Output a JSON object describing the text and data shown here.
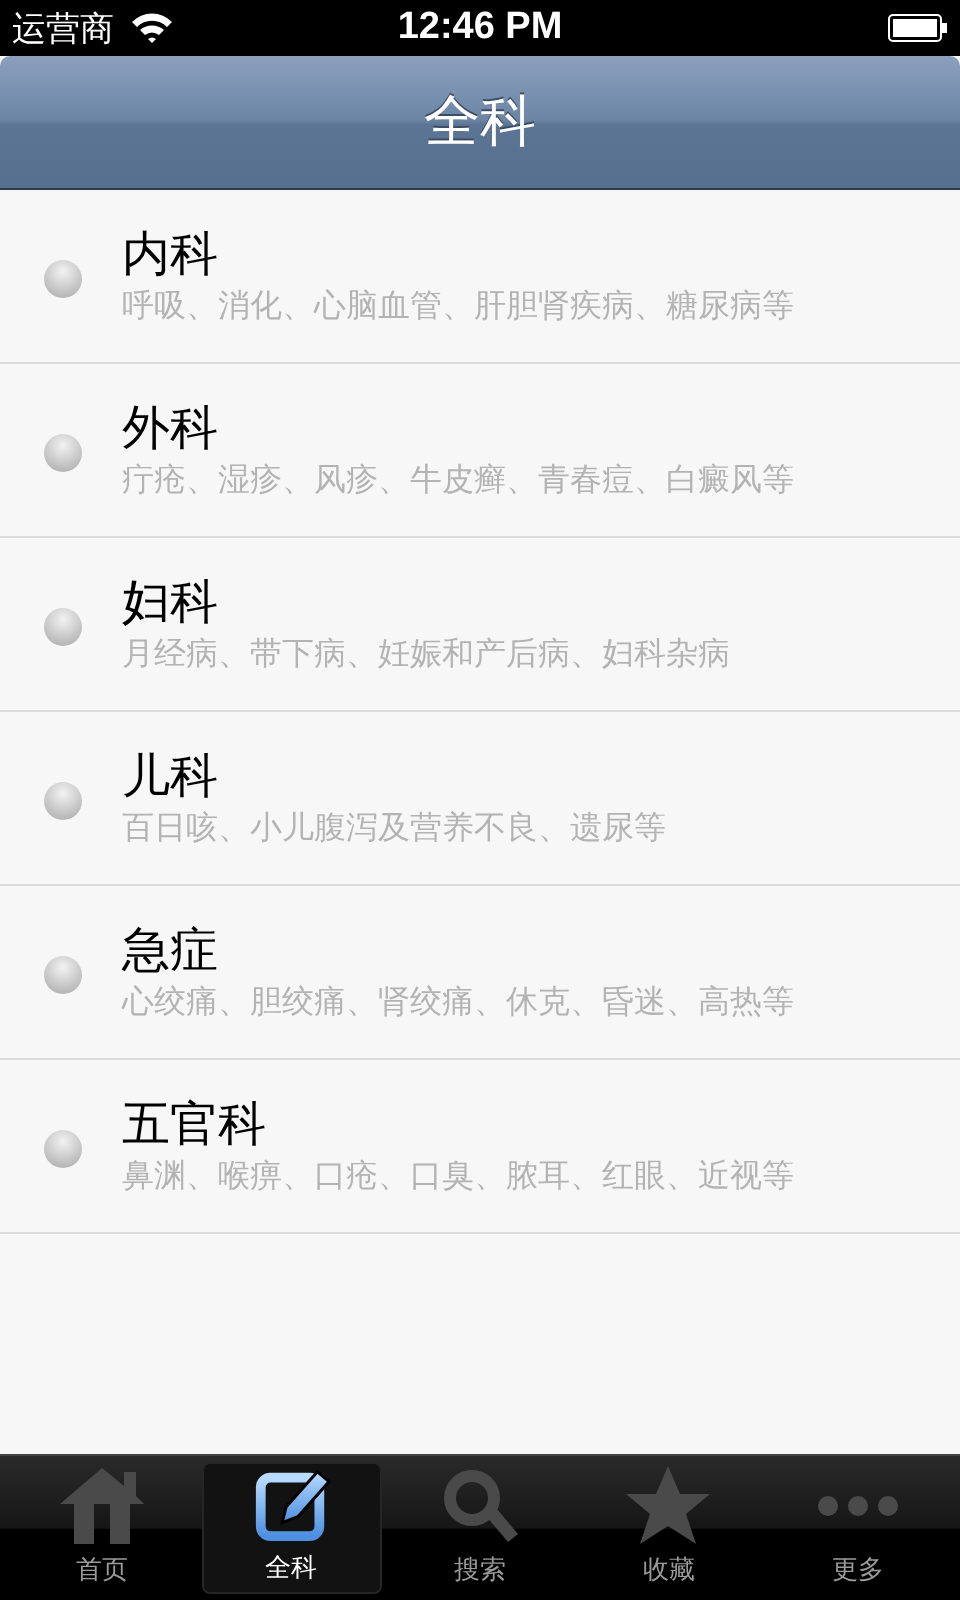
{
  "status_bar": {
    "carrier": "运营商",
    "time": "12:46 PM"
  },
  "nav_bar": {
    "title": "全科"
  },
  "departments": [
    {
      "name": "内科",
      "description": "呼吸、消化、心脑血管、肝胆肾疾病、糖尿病等"
    },
    {
      "name": "外科",
      "description": "疔疮、湿疹、风疹、牛皮癣、青春痘、白癜风等"
    },
    {
      "name": "妇科",
      "description": "月经病、带下病、妊娠和产后病、妇科杂病"
    },
    {
      "name": "儿科",
      "description": "百日咳、小儿腹泻及营养不良、遗尿等"
    },
    {
      "name": "急症",
      "description": "心绞痛、胆绞痛、肾绞痛、休克、昏迷、高热等"
    },
    {
      "name": "五官科",
      "description": "鼻渊、喉痹、口疮、口臭、脓耳、红眼、近视等"
    }
  ],
  "tab_bar": [
    {
      "kind": "home",
      "label": "首页",
      "selected": false
    },
    {
      "kind": "edit",
      "label": "全科",
      "selected": true
    },
    {
      "kind": "search",
      "label": "搜索",
      "selected": false
    },
    {
      "kind": "star",
      "label": "收藏",
      "selected": false
    },
    {
      "kind": "more",
      "label": "更多",
      "selected": false
    }
  ]
}
